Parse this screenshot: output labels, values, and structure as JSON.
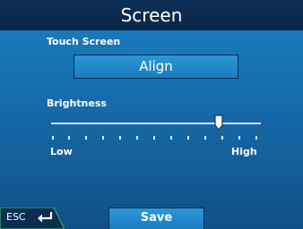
{
  "header": {
    "title": "Screen"
  },
  "touch_screen": {
    "label": "Touch Screen",
    "align_label": "Align"
  },
  "brightness": {
    "label": "Brightness",
    "low_label": "Low",
    "high_label": "High",
    "level": 0.8
  },
  "footer": {
    "esc_label": "ESC",
    "save_label": "Save"
  },
  "icons": {
    "back": "return-arrow-icon"
  }
}
